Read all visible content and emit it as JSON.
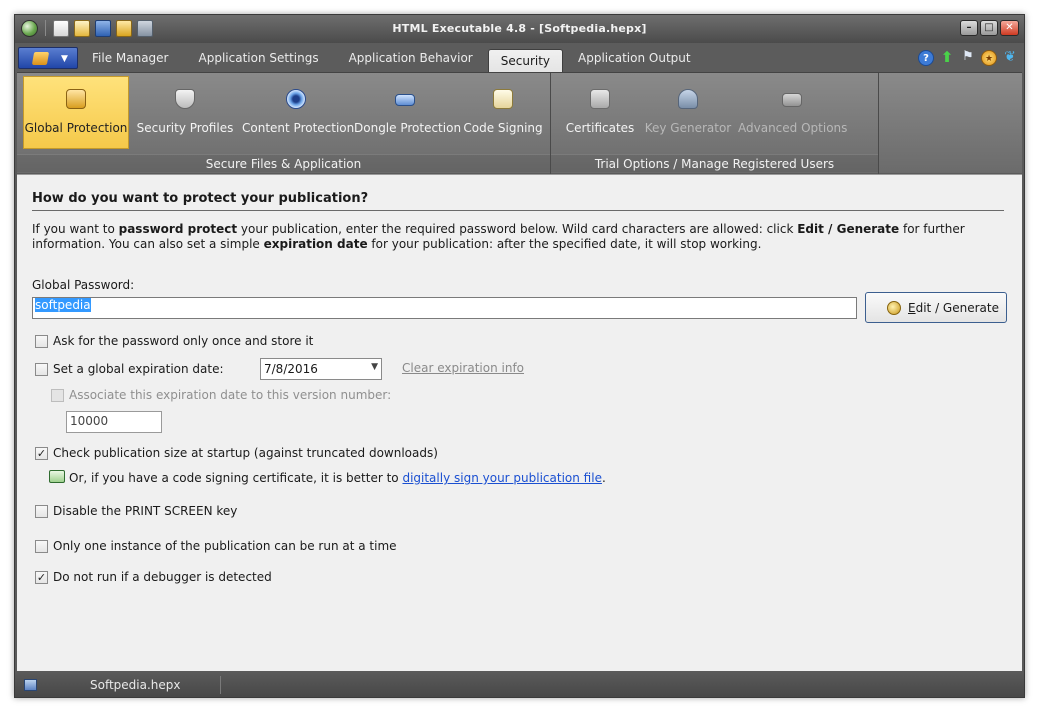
{
  "window": {
    "title": "HTML Executable 4.8 - [Softpedia.hepx]"
  },
  "tabs": [
    {
      "label": "File Manager"
    },
    {
      "label": "Application Settings"
    },
    {
      "label": "Application Behavior"
    },
    {
      "label": "Security"
    },
    {
      "label": "Application Output"
    }
  ],
  "active_tab": "Security",
  "ribbon": {
    "group1": {
      "label": "Secure Files & Application",
      "buttons": [
        {
          "label": "Global Protection",
          "icon": "padlock-icon"
        },
        {
          "label": "Security Profiles",
          "icon": "shield-icon"
        },
        {
          "label": "Content Protection",
          "icon": "eye-icon"
        },
        {
          "label": "Dongle Protection",
          "icon": "usb-dongle-icon"
        },
        {
          "label": "Code Signing",
          "icon": "certificate-icon"
        }
      ]
    },
    "group2": {
      "label": "Trial Options / Manage Registered Users",
      "buttons": [
        {
          "label": "Certificates",
          "icon": "certificates-icon"
        },
        {
          "label": "Key Generator",
          "icon": "key-generator-icon"
        },
        {
          "label": "Advanced Options",
          "icon": "advanced-options-icon"
        }
      ]
    }
  },
  "content": {
    "heading": "How do you want to protect your publication?",
    "intro": {
      "p1": "If you want to ",
      "b1": "password protect",
      "p2": " your publication, enter the required password below. Wild card characters are allowed: click ",
      "b2": "Edit / Generate",
      "p3": " for further information. You can also set a simple ",
      "b3": "expiration date",
      "p4": " for your publication: after the specified date, it will stop working."
    },
    "password_label": "Global Password:",
    "password_value": "softpedia",
    "edit_button": {
      "mnemonic": "E",
      "rest": "dit / Generate"
    },
    "ask_once": {
      "label": "Ask for the password only once and store it",
      "checked": false
    },
    "expiration": {
      "label": "Set a global expiration date:",
      "checked": false,
      "date": "7/8/2016",
      "clear_link": "Clear expiration info"
    },
    "version_assoc": {
      "label": "Associate this expiration date to this version number:",
      "checked": false,
      "value": "10000"
    },
    "check_size": {
      "label": "Check publication size at startup (against truncated downloads)",
      "checked": true
    },
    "signing_note": {
      "text": "Or, if you have a code signing certificate, it is better to ",
      "link": "digitally sign your publication file",
      "suffix": "."
    },
    "print_screen": {
      "label": "Disable the PRINT SCREEN key",
      "checked": false
    },
    "single_instance": {
      "label": "Only one instance of the publication can be run at a time",
      "checked": false
    },
    "debugger": {
      "label": "Do not run if a debugger is detected",
      "checked": true
    }
  },
  "statusbar": {
    "file": "Softpedia.hepx"
  }
}
